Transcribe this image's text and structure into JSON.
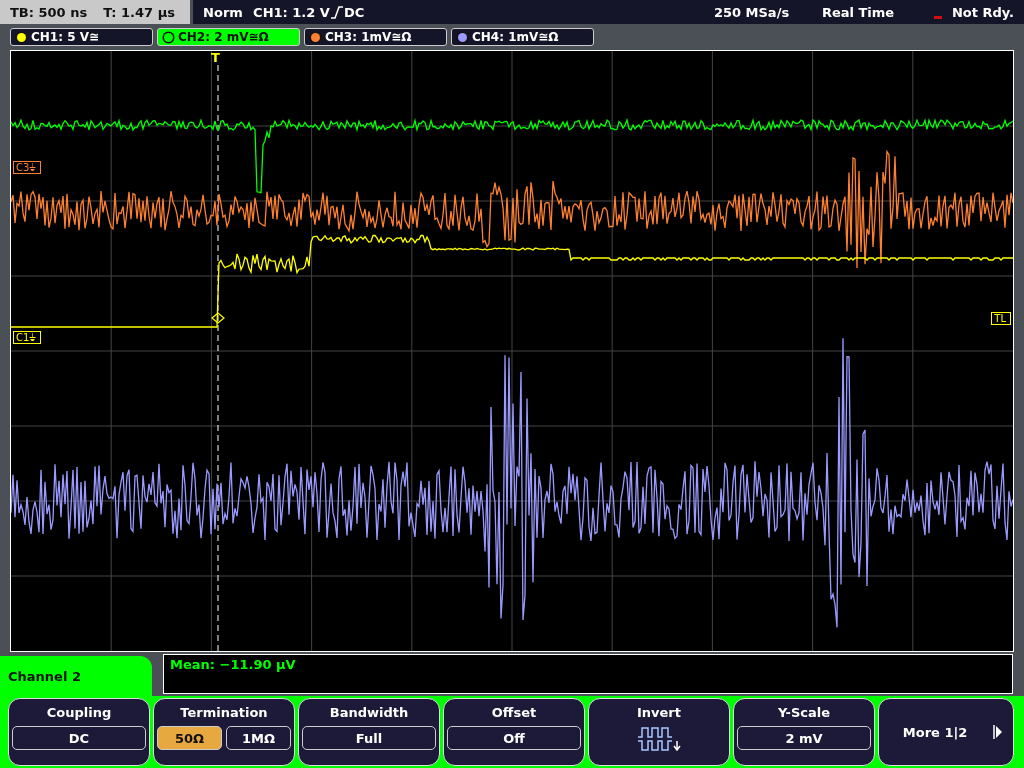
{
  "top_bar": {
    "timebase": "TB: 500 ns",
    "trigger_time": "T: 1.47 µs",
    "mode": "Norm",
    "trigger_source": "CH1: 1.2 V",
    "trigger_coupling": "DC",
    "sample_rate": "250 MSa/s",
    "acquisition": "Real Time",
    "status": "Not Rdy."
  },
  "channel_tabs": [
    {
      "label": "CH1: 5 V≅",
      "color": "#ffff00",
      "selected": false
    },
    {
      "label": "CH2: 2 mV≅Ω",
      "color": "#00ff00",
      "selected": true
    },
    {
      "label": "CH3: 1mV≅Ω",
      "color": "#ff8030",
      "selected": false
    },
    {
      "label": "CH4: 1mV≅Ω",
      "color": "#9a9aff",
      "selected": false
    }
  ],
  "traces": [
    {
      "kind": "flat",
      "color": "#00ff00"
    },
    {
      "kind": "noise",
      "color": "#ff8030",
      "tag": "C3⏚"
    },
    {
      "kind": "step",
      "color": "#ffff00",
      "tag": "C1⏚"
    },
    {
      "kind": "burst",
      "color": "#9a9aff"
    }
  ],
  "trigger_marker": "T",
  "trigger_level_tag": "TL",
  "measurement": "Mean: −11.90 µV",
  "menu_title": "Channel 2",
  "softkeys": [
    {
      "kind": "value",
      "title": "Coupling",
      "value": "DC"
    },
    {
      "kind": "choice",
      "title": "Termination",
      "options": [
        {
          "label": "50Ω",
          "selected": true
        },
        {
          "label": "1MΩ",
          "selected": false
        }
      ]
    },
    {
      "kind": "value",
      "title": "Bandwidth",
      "value": "Full"
    },
    {
      "kind": "value",
      "title": "Offset",
      "value": "Off"
    },
    {
      "kind": "invert",
      "title": "Invert"
    },
    {
      "kind": "value",
      "title": "Y-Scale",
      "value": "2 mV"
    },
    {
      "kind": "more",
      "title": "More 1|2"
    }
  ]
}
